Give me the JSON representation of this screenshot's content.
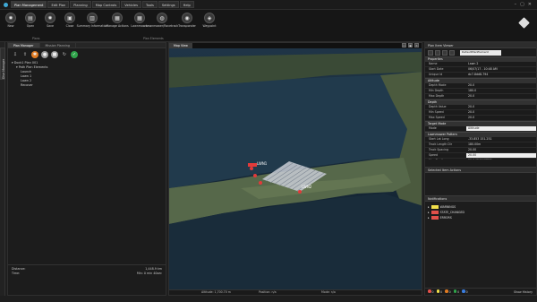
{
  "menubar": {
    "items": [
      {
        "label": "Plan Management",
        "active": true
      },
      {
        "label": "Edit Plan"
      },
      {
        "label": "Planning"
      },
      {
        "label": "Map Controls"
      },
      {
        "label": "Vehicles"
      },
      {
        "label": "Tools"
      },
      {
        "label": "Settings"
      },
      {
        "label": "Help"
      }
    ]
  },
  "ribbon": {
    "buttons": [
      {
        "label": "New",
        "icon": "new-plan-icon",
        "glyph": "✸"
      },
      {
        "label": "Open",
        "icon": "open-folder-icon",
        "glyph": "▤"
      },
      {
        "label": "Save",
        "icon": "save-icon",
        "glyph": "✸"
      },
      {
        "label": "Close",
        "icon": "close-plan-icon",
        "glyph": "▣"
      },
      {
        "label": "Summary\nInformation",
        "icon": "summary-chart-icon",
        "glyph": "▥"
      },
      {
        "label": "Manage Actions",
        "icon": "manage-actions-icon",
        "glyph": "▦"
      },
      {
        "label": "Lawnmower",
        "icon": "lawnmower-icon",
        "glyph": "▦"
      },
      {
        "label": "Lawnmower/Racetrack",
        "icon": "racetrack-icon",
        "glyph": "◍"
      },
      {
        "label": "Transponder",
        "icon": "transponder-icon",
        "glyph": "◉"
      },
      {
        "label": "Waypoint",
        "icon": "waypoint-icon",
        "glyph": "◈"
      }
    ],
    "group_labels": {
      "plans": "Plans",
      "plan_elements": "Plan Elements"
    }
  },
  "left_tabs": [
    "Dive Manager"
  ],
  "left_panel": {
    "tabs": [
      {
        "label": "Plan Manager",
        "active": true
      },
      {
        "label": "Mission Planning"
      }
    ],
    "toolbar_icons": [
      {
        "name": "move-down-icon",
        "glyph": "⇩",
        "style": "plain"
      },
      {
        "name": "move-up-icon",
        "glyph": "⇧",
        "style": "plain"
      },
      {
        "name": "settings-icon",
        "glyph": "✱",
        "style": "orange"
      },
      {
        "name": "record-icon",
        "glyph": "●",
        "style": "grey"
      },
      {
        "name": "layers-icon",
        "glyph": "■",
        "style": "grey"
      },
      {
        "name": "refresh-icon",
        "glyph": "↻",
        "style": "plain"
      },
      {
        "name": "validate-icon",
        "glyph": "✓",
        "style": "green"
      }
    ],
    "tree": [
      {
        "label": "▾ Dock1 Plan 001",
        "indent": 0
      },
      {
        "label": "▾ Path Plan Elements",
        "indent": 1
      },
      {
        "label": "Launch",
        "indent": 2
      },
      {
        "label": "Lawn 1",
        "indent": 2
      },
      {
        "label": "Lawn 2",
        "indent": 2
      },
      {
        "label": "Recover",
        "indent": 2
      }
    ],
    "footer": [
      {
        "key": "Distance:",
        "value": "1,448.9 km"
      },
      {
        "key": "Time:",
        "value": "Min: 0 min 40sec"
      }
    ]
  },
  "map": {
    "tab_label": "Map View",
    "controls": [
      "▢",
      "▣",
      "✕"
    ],
    "labels": [
      {
        "text": "LWN1"
      },
      {
        "text": "LWN2"
      }
    ],
    "status": {
      "altitude": "Altitude: 1,700.70 m",
      "position": "Position: n/a",
      "view": "Mode: n/a"
    }
  },
  "right_panel": {
    "title": "Plan Item Viewer",
    "selected": "DefaultPlanElement",
    "sections": [
      {
        "title": "Properties",
        "rows": [
          {
            "key": "Name",
            "value": "Lawn 2"
          },
          {
            "key": "Start Date",
            "value": "06/07/17 - 10:48 AM"
          },
          {
            "key": "Unique Id",
            "value": "dc7-8dd8-794"
          }
        ]
      },
      {
        "title": "Altitude",
        "rows": [
          {
            "key": "Depth Mode",
            "value": "20.0"
          },
          {
            "key": "Min Depth",
            "value": "180.0"
          },
          {
            "key": "Max Depth",
            "value": "20.0"
          }
        ]
      },
      {
        "title": "Depth",
        "rows": [
          {
            "key": "Depth Value",
            "value": "20.0"
          },
          {
            "key": "Min Speed",
            "value": "20.0"
          },
          {
            "key": "Max Speed",
            "value": "20.0"
          }
        ]
      },
      {
        "title": "Target Mode",
        "rows": [
          {
            "key": "Mode",
            "value": "Altitude",
            "white": true
          }
        ]
      },
      {
        "title": "Lawnmower Pattern",
        "rows": [
          {
            "key": "Start Lat Long",
            "value": "-33.853 151.251"
          },
          {
            "key": "Track Length Dir",
            "value": "180.00m"
          },
          {
            "key": "Track Spacing",
            "value": "20.00"
          },
          {
            "key": "Speed",
            "value": "20.00",
            "white": true
          },
          {
            "key": "Max Depth",
            "value": "90.0 (EXPORTED)"
          }
        ]
      }
    ],
    "subpanel_title": "Selected Item Actions",
    "notifications_title": "Notifications",
    "notifications": [
      {
        "label": "WARNINGS",
        "color": "#f2e04a"
      },
      {
        "label": "STATE_CHANGED",
        "color": "#e2504a"
      },
      {
        "label": "ERRORS",
        "color": "#e2504a"
      }
    ],
    "footer_counts": [
      {
        "color": "#e2504a",
        "count": "0"
      },
      {
        "color": "#f2e04a",
        "count": "0"
      },
      {
        "color": "#e07b22",
        "count": "0"
      },
      {
        "color": "#2fa34a",
        "count": "0"
      },
      {
        "color": "#3a7de0",
        "count": "0"
      }
    ],
    "footer_label": "Show History"
  }
}
